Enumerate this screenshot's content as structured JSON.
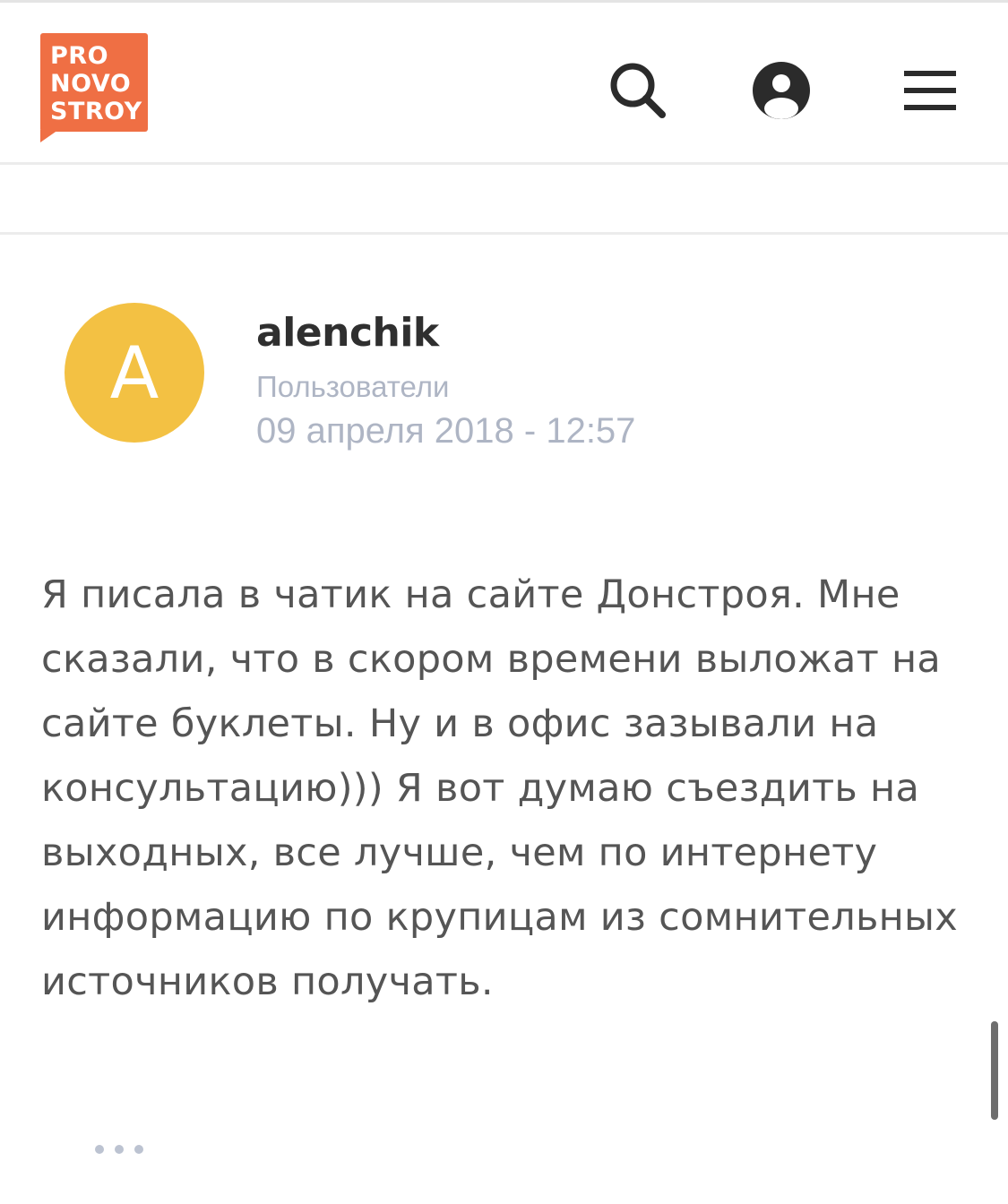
{
  "header": {
    "logo_lines": [
      "PRO",
      "NOVO",
      "STROY"
    ],
    "icons": {
      "search": "search-icon",
      "account": "user-icon",
      "menu": "menu-icon"
    }
  },
  "post": {
    "avatar_letter": "A",
    "avatar_color": "#f3c143",
    "username": "alenchik",
    "role": "Пользователи",
    "date": "09 апреля 2018 - 12:57",
    "body_lines": [
      "Я писала в чатик на сайте Донстроя. Мне",
      "сказали, что в скором времени выложат на",
      "сайте буклеты. Ну и в офис зазывали на",
      "консультацию))) Я вот думаю съездить на",
      "выходных, все лучше, чем по интернету",
      "информацию по крупицам из сомнительных",
      "источников получать."
    ]
  },
  "colors": {
    "brand": "#ef6f44",
    "muted": "#aeb5c4",
    "text": "#555555"
  }
}
